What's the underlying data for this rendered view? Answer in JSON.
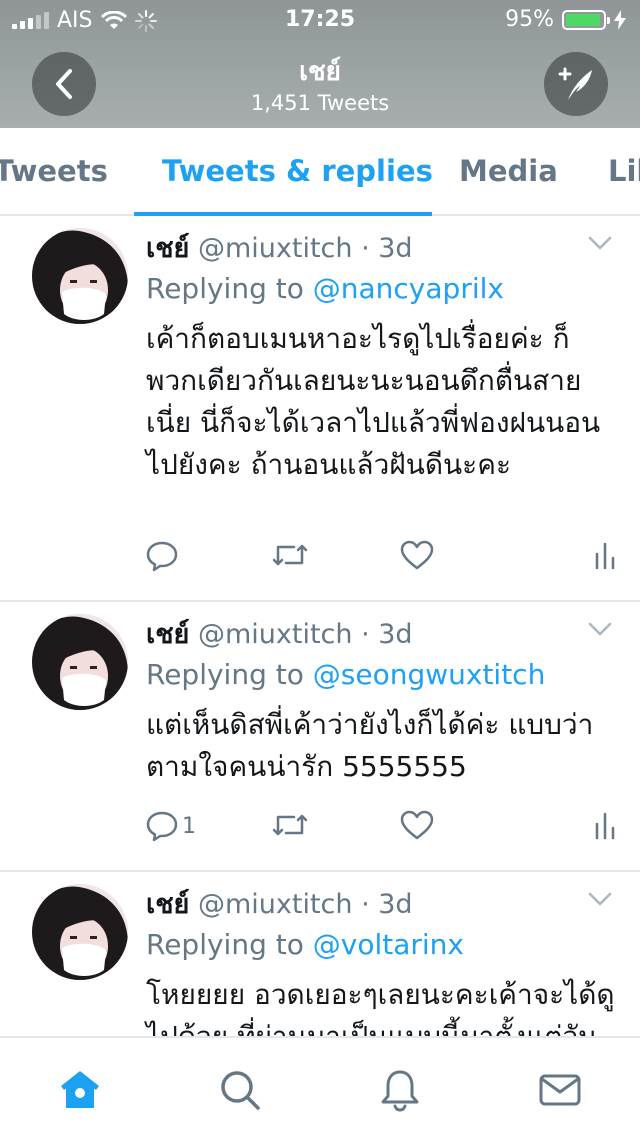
{
  "status_bar": {
    "carrier": "AIS",
    "time": "17:25",
    "battery": "95%",
    "battery_level": 0.95
  },
  "header": {
    "back_icon": "chevron-left-icon",
    "title": "เชย์",
    "subtitle": "1,451 Tweets",
    "compose_icon": "compose-icon"
  },
  "tabs": [
    {
      "label": "Tweets",
      "active": false
    },
    {
      "label": "Tweets & replies",
      "active": true
    },
    {
      "label": "Media",
      "active": false
    },
    {
      "label": "Lik",
      "active": false
    }
  ],
  "tweets": [
    {
      "name": "เชย์",
      "handle": "@miuxtitch",
      "time": "· 3d",
      "replying_prefix": "Replying to",
      "replying_to": "@nancyaprilx",
      "text": "เค้าก็ตอบเมนหาอะไรดูไปเรื่อยค่ะ ก็พวกเดียวกันเลยนะนะนอนดึกตื่นสายเนี่ย นี่ก็จะได้เวลาไปแล้วพี่ฟองฝนนอนไปยังคะ ถ้านอนแล้วฝันดีนะคะ",
      "reply_count": ""
    },
    {
      "name": "เชย์",
      "handle": "@miuxtitch",
      "time": "· 3d",
      "replying_prefix": "Replying to",
      "replying_to": "@seongwuxtitch",
      "text": "แต่เห็นดิสพี่เค้าว่ายังไงก็ได้ค่ะ แบบว่าตามใจคนน่ารัก 5555555",
      "reply_count": "1"
    },
    {
      "name": "เชย์",
      "handle": "@miuxtitch",
      "time": "· 3d",
      "replying_prefix": "Replying to",
      "replying_to": "@voltarinx",
      "text": "โหยยยย อวดเยอะๆเลยนะคะเค้าจะได้ดูไปด้วย ที่ผ่านมาเป็นแบบนี้มาตั้งแต่วันนั้นจนถึงวันนี้ค่ะ",
      "reply_count": ""
    }
  ],
  "action_icons": [
    "reply-icon",
    "retweet-icon",
    "like-icon",
    "analytics-icon"
  ],
  "bottom_nav": [
    "home-icon",
    "search-icon",
    "notifications-icon",
    "messages-icon"
  ],
  "colors": {
    "accent": "#1da1f2",
    "secondary_text": "#657786",
    "battery": "#4cd964"
  }
}
